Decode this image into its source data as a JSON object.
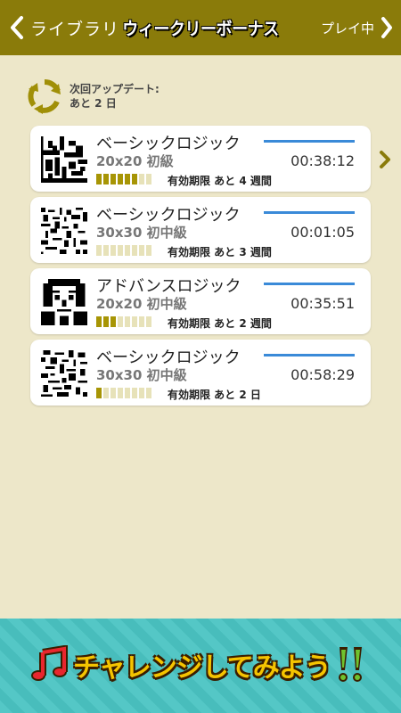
{
  "header": {
    "back_label": "ライブラリ",
    "title": "ウィークリーボーナス",
    "right_label": "プレイ中",
    "bg_color": "#8a7b0a"
  },
  "update": {
    "line1": "次回アップデート:",
    "line2": "あと 2 日",
    "icon": "refresh-icon"
  },
  "puzzles": [
    {
      "title": "ベーシックロジック",
      "size": "20x20 初級",
      "time": "00:38:12",
      "expiry": "有効期限 あと 4 週間",
      "progress_segments": 6,
      "total_segments": 8
    },
    {
      "title": "ベーシックロジック",
      "size": "30x30 初中級",
      "time": "00:01:05",
      "expiry": "有効期限 あと 3 週間",
      "progress_segments": 0,
      "total_segments": 8
    },
    {
      "title": "アドバンスロジック",
      "size": "20x20 初中級",
      "time": "00:35:51",
      "expiry": "有効期限 あと 2 週間",
      "progress_segments": 3,
      "total_segments": 8
    },
    {
      "title": "ベーシックロジック",
      "size": "30x30 初中級",
      "time": "00:58:29",
      "expiry": "有効期限 あと 2 日",
      "progress_segments": 1,
      "total_segments": 8
    }
  ],
  "banner": {
    "text": "チャレンジしてみよう",
    "icon_left": "music-note-icon",
    "icon_right": "double-exclamation-icon"
  }
}
